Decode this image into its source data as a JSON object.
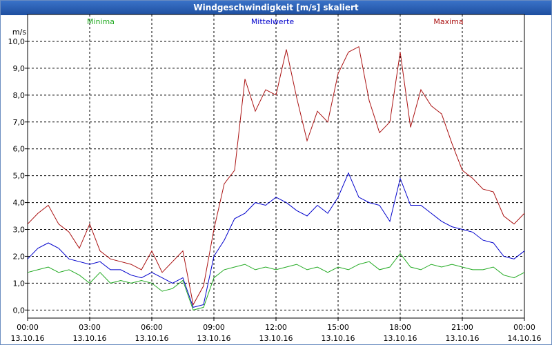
{
  "title": "Windgeschwindigkeit [m/s] skaliert",
  "chart_data": {
    "type": "line",
    "title": "Windgeschwindigkeit [m/s] skaliert",
    "ylabel": "m/s",
    "ylim": [
      -0.3,
      11.0
    ],
    "xlim_hours": [
      0,
      24
    ],
    "y_ticks": [
      "0,0",
      "1,0",
      "2,0",
      "3,0",
      "4,0",
      "5,0",
      "6,0",
      "7,0",
      "8,0",
      "9,0",
      "10,0"
    ],
    "x_ticks": [
      {
        "time": "00:00",
        "date": "13.10.16"
      },
      {
        "time": "03:00",
        "date": "13.10.16"
      },
      {
        "time": "06:00",
        "date": "13.10.16"
      },
      {
        "time": "09:00",
        "date": "13.10.16"
      },
      {
        "time": "12:00",
        "date": "13.10.16"
      },
      {
        "time": "15:00",
        "date": "13.10.16"
      },
      {
        "time": "18:00",
        "date": "13.10.16"
      },
      {
        "time": "21:00",
        "date": "13.10.16"
      },
      {
        "time": "00:00",
        "date": "14.10.16"
      }
    ],
    "grid": true,
    "legend_position": "top",
    "series": [
      {
        "name": "Minima",
        "color": "#22aa22",
        "x_hours": [
          0,
          0.5,
          1,
          1.5,
          2,
          2.5,
          3,
          3.5,
          4,
          4.5,
          5,
          5.5,
          6,
          6.5,
          7,
          7.5,
          8,
          8.5,
          9,
          9.5,
          10,
          10.5,
          11,
          11.5,
          12,
          12.5,
          13,
          13.5,
          14,
          14.5,
          15,
          15.5,
          16,
          16.5,
          17,
          17.5,
          18,
          18.5,
          19,
          19.5,
          20,
          20.5,
          21,
          21.5,
          22,
          22.5,
          23,
          23.5,
          24
        ],
        "values": [
          1.4,
          1.5,
          1.6,
          1.4,
          1.5,
          1.3,
          1.0,
          1.4,
          1.0,
          1.1,
          1.0,
          1.1,
          1.0,
          0.7,
          0.8,
          1.1,
          0.0,
          0.1,
          1.2,
          1.5,
          1.6,
          1.7,
          1.5,
          1.6,
          1.5,
          1.6,
          1.7,
          1.5,
          1.6,
          1.4,
          1.6,
          1.5,
          1.7,
          1.8,
          1.5,
          1.6,
          2.1,
          1.6,
          1.5,
          1.7,
          1.6,
          1.7,
          1.6,
          1.5,
          1.5,
          1.6,
          1.3,
          1.2,
          1.4
        ]
      },
      {
        "name": "Mittelwerte",
        "color": "#0000cc",
        "x_hours": [
          0,
          0.5,
          1,
          1.5,
          2,
          2.5,
          3,
          3.5,
          4,
          4.5,
          5,
          5.5,
          6,
          6.5,
          7,
          7.5,
          8,
          8.5,
          9,
          9.5,
          10,
          10.5,
          11,
          11.5,
          12,
          12.5,
          13,
          13.5,
          14,
          14.5,
          15,
          15.5,
          16,
          16.5,
          17,
          17.5,
          18,
          18.5,
          19,
          19.5,
          20,
          20.5,
          21,
          21.5,
          22,
          22.5,
          23,
          23.5,
          24
        ],
        "values": [
          1.9,
          2.3,
          2.5,
          2.3,
          1.9,
          1.8,
          1.7,
          1.8,
          1.5,
          1.5,
          1.3,
          1.2,
          1.4,
          1.2,
          1.0,
          1.2,
          0.1,
          0.2,
          2.0,
          2.6,
          3.4,
          3.6,
          4.0,
          3.9,
          4.2,
          4.0,
          3.7,
          3.5,
          3.9,
          3.6,
          4.2,
          5.1,
          4.2,
          4.0,
          3.9,
          3.3,
          4.9,
          3.9,
          3.9,
          3.6,
          3.3,
          3.1,
          3.0,
          2.9,
          2.6,
          2.5,
          2.0,
          1.9,
          2.2
        ]
      },
      {
        "name": "Maxima",
        "color": "#aa1111",
        "x_hours": [
          0,
          0.5,
          1,
          1.5,
          2,
          2.5,
          3,
          3.5,
          4,
          4.5,
          5,
          5.5,
          6,
          6.5,
          7,
          7.5,
          8,
          8.5,
          9,
          9.5,
          10,
          10.5,
          11,
          11.5,
          12,
          12.5,
          13,
          13.5,
          14,
          14.5,
          15,
          15.5,
          16,
          16.5,
          17,
          17.5,
          18,
          18.5,
          19,
          19.5,
          20,
          20.5,
          21,
          21.5,
          22,
          22.5,
          23,
          23.5,
          24
        ],
        "values": [
          3.2,
          3.6,
          3.9,
          3.2,
          2.9,
          2.3,
          3.2,
          2.2,
          1.9,
          1.8,
          1.7,
          1.5,
          2.2,
          1.4,
          1.8,
          2.2,
          0.2,
          0.9,
          3.0,
          4.7,
          5.2,
          8.6,
          7.4,
          8.2,
          8.0,
          9.7,
          7.9,
          6.3,
          7.4,
          7.0,
          8.8,
          9.6,
          9.8,
          7.8,
          6.6,
          7.0,
          9.6,
          6.8,
          8.2,
          7.6,
          7.3,
          6.2,
          5.2,
          4.9,
          4.5,
          4.4,
          3.5,
          3.2,
          3.6
        ]
      }
    ]
  }
}
